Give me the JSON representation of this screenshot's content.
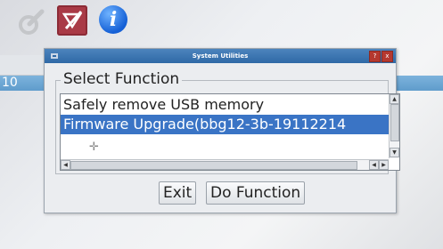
{
  "background": {
    "window_text": "10"
  },
  "toolbar": {
    "icons": [
      "tool-icon",
      "config-icon",
      "info-icon"
    ],
    "info_glyph": "i",
    "accent": "#a93a46"
  },
  "dialog": {
    "title": "System Utilities",
    "help_glyph": "?",
    "close_glyph": "x",
    "group_title": "Select Function",
    "items": [
      {
        "label": "Safely remove USB memory",
        "selected": false
      },
      {
        "label": "Firmware Upgrade(bbg12-3b-19112214",
        "selected": true
      }
    ],
    "buttons": {
      "exit": "Exit",
      "do_function": "Do Function"
    },
    "selection_color": "#3a74c5"
  }
}
